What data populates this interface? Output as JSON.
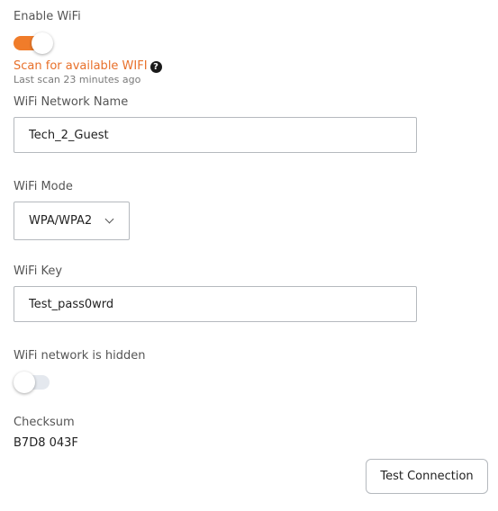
{
  "enable_wifi": {
    "label": "Enable WiFi",
    "enabled": true
  },
  "scan": {
    "link_text": "Scan for available WIFI",
    "help_icon": "question-circle-icon",
    "help_glyph": "?",
    "last_scan": "Last scan 23 minutes ago"
  },
  "network_name": {
    "label": "WiFi Network Name",
    "value": "Tech_2_Guest"
  },
  "mode": {
    "label": "WiFi Mode",
    "selected": "WPA/WPA2",
    "icon": "chevron-down-icon"
  },
  "key": {
    "label": "WiFi Key",
    "value": "Test_pass0wrd"
  },
  "hidden": {
    "label": "WiFi network is hidden",
    "enabled": false
  },
  "checksum": {
    "label": "Checksum",
    "value": "B7D8 043F"
  },
  "actions": {
    "test_connection": "Test Connection"
  },
  "colors": {
    "accent": "#f07c2a",
    "link": "#e8702a",
    "toggle_off": "#e4e8ee",
    "border": "#b5b9be"
  }
}
